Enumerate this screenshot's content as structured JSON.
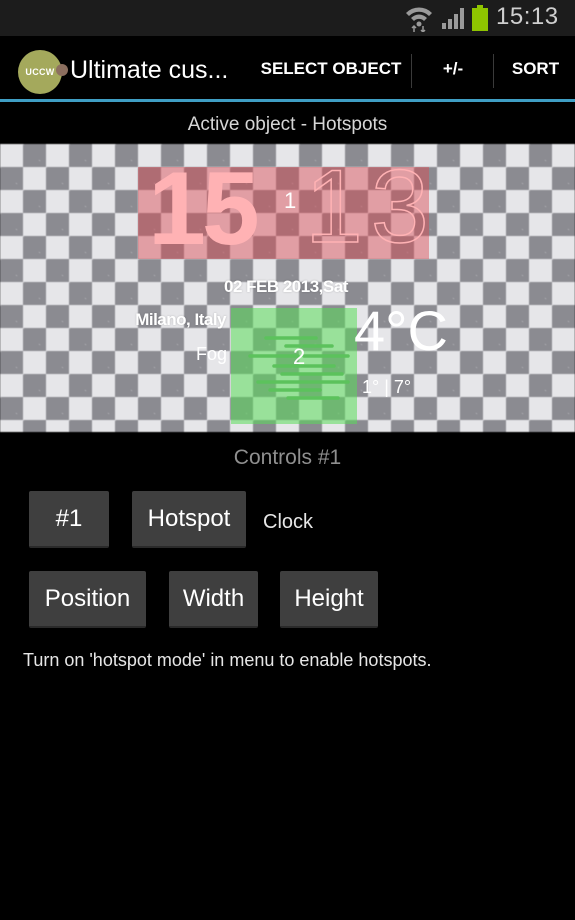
{
  "status_bar": {
    "time": "15:13",
    "icons": [
      "wifi-icon",
      "signal-icon",
      "battery-icon"
    ],
    "battery_color": "#8fc400"
  },
  "action_bar": {
    "app_icon_text": "UCCW",
    "title": "Ultimate cus...",
    "actions": [
      {
        "label": "SELECT OBJECT"
      },
      {
        "label": "+/-"
      },
      {
        "label": "SORT"
      }
    ],
    "accent_color": "#3f9ec4"
  },
  "subheader": {
    "text": "Active object - Hotspots"
  },
  "preview": {
    "clock_hours": "15",
    "clock_minutes": "13",
    "hotspot_1_label": "1",
    "hotspot_2_label": "2",
    "date": "02 FEB 2013,Sat",
    "location": "Milano, Italy",
    "condition": "Fog",
    "condition_icon": "fog-icon",
    "temperature": "4°C",
    "hi_lo": "1° | 7°",
    "hotspot_1_color": "#dc4650",
    "hotspot_2_color": "#5adc5a"
  },
  "controls": {
    "title": "Controls #1",
    "row1": {
      "index_button": "#1",
      "type_button": "Hotspot",
      "target_label": "Clock"
    },
    "row2": {
      "position_button": "Position",
      "width_button": "Width",
      "height_button": "Height"
    },
    "hint": "Turn on 'hotspot mode' in menu to enable hotspots."
  }
}
